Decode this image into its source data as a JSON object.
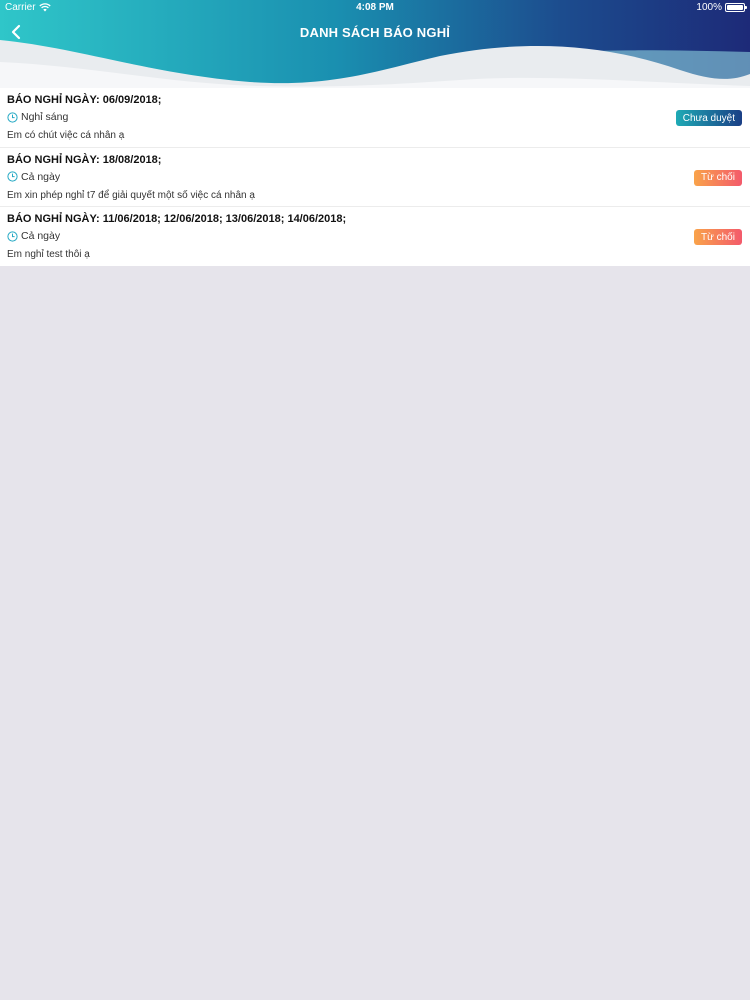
{
  "status_bar": {
    "carrier": "Carrier",
    "time": "4:08 PM",
    "battery": "100%"
  },
  "header": {
    "title": "DANH SÁCH BÁO NGHỈ"
  },
  "colors": {
    "badge_pending": "#1b6f9e",
    "badge_rejected": "#f5716a",
    "clock_icon": "#25a9c4",
    "background": "#e6e4eb"
  },
  "items": [
    {
      "title": "BÁO NGHỈ NGÀY:  06/09/2018;",
      "type": "Nghỉ sáng",
      "reason": "Em có chút việc cá nhân ạ",
      "status": "Chưa duyệt"
    },
    {
      "title": "BÁO NGHỈ NGÀY:  18/08/2018;",
      "type": "Cả ngày",
      "reason": "Em xin phép nghỉ t7 để giải quyết một số việc cá nhân ạ",
      "status": "Từ chối"
    },
    {
      "title": "BÁO NGHỈ NGÀY:  11/06/2018; 12/06/2018; 13/06/2018; 14/06/2018;",
      "type": "Cả ngày",
      "reason": "Em nghỉ test thôi ạ",
      "status": "Từ chối"
    }
  ]
}
